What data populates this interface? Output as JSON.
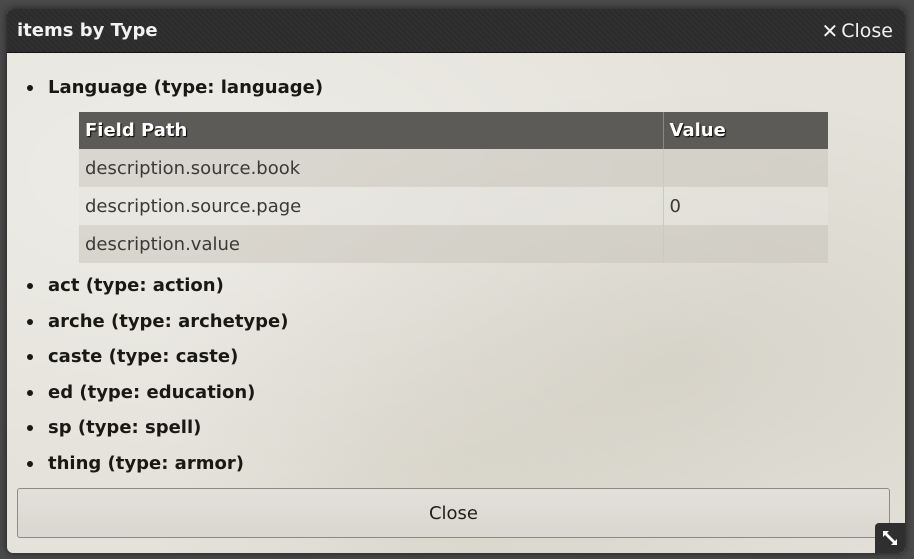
{
  "window": {
    "title": "items by Type",
    "header_close_label": "Close",
    "header_close_symbol": "✕"
  },
  "types": [
    {
      "label": "Language (type: language)",
      "table": {
        "headers": [
          "Field Path",
          "Value"
        ],
        "rows": [
          {
            "path": "description.source.book",
            "value": ""
          },
          {
            "path": "description.source.page",
            "value": "0"
          },
          {
            "path": "description.value",
            "value": ""
          }
        ]
      }
    },
    {
      "label": "act (type: action)"
    },
    {
      "label": "arche (type: archetype)"
    },
    {
      "label": "caste (type: caste)"
    },
    {
      "label": "ed (type: education)"
    },
    {
      "label": "sp (type: spell)"
    },
    {
      "label": "thing (type: armor)"
    }
  ],
  "footer": {
    "close_button_label": "Close"
  },
  "icons": {
    "header_close": "close-icon",
    "resize": "resize-icon"
  },
  "colors": {
    "header_bg": "#2c2c2c",
    "body_bg": "#e4e2da",
    "table_header_bg": "#5c5b57"
  }
}
